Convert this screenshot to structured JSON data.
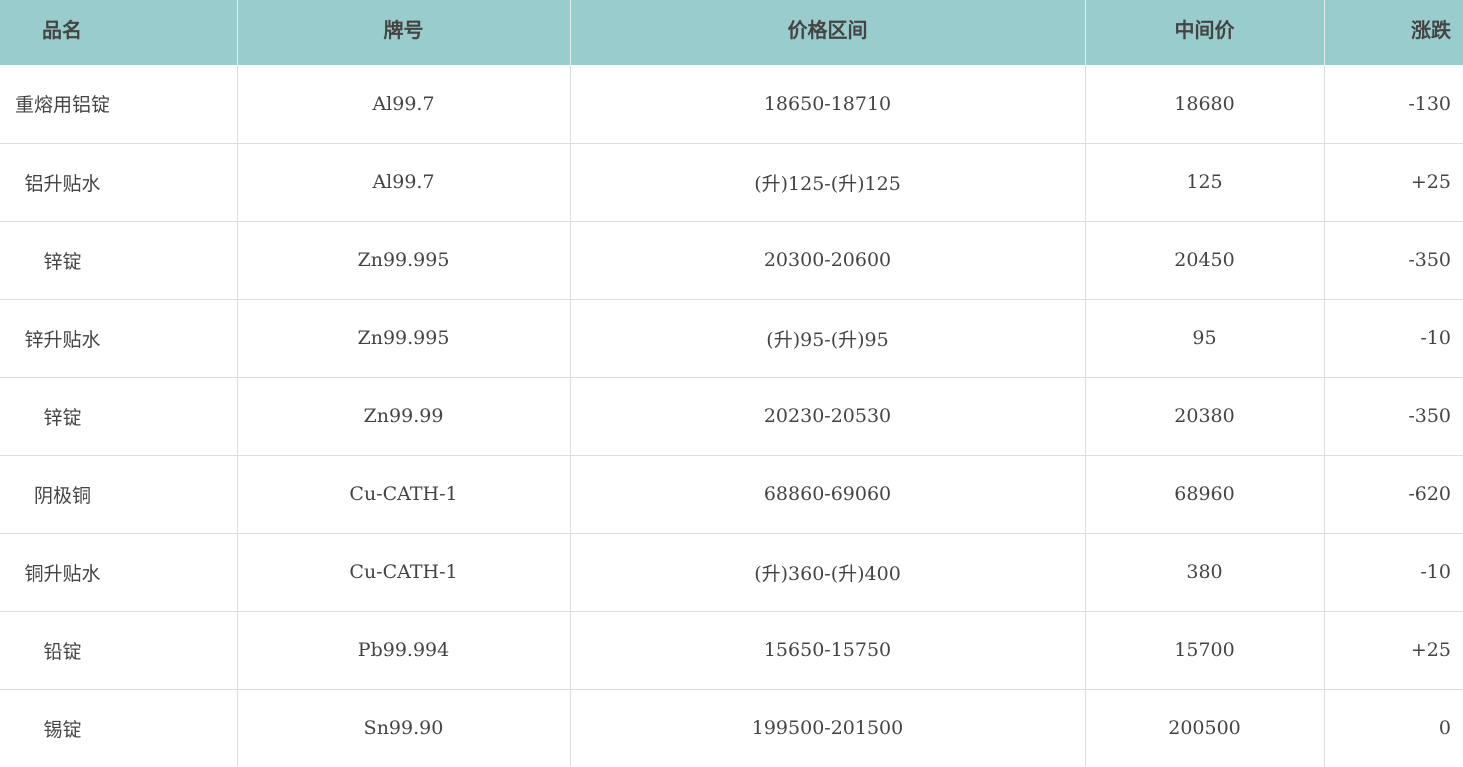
{
  "table": {
    "headers": {
      "name": "品名",
      "grade": "牌号",
      "range": "价格区间",
      "mid": "中间价",
      "change": "涨跌"
    },
    "rows": [
      {
        "name": "重熔用铝锭",
        "grade": "Al99.7",
        "range": "18650-18710",
        "mid": "18680",
        "change": "-130"
      },
      {
        "name": "铝升贴水",
        "grade": "Al99.7",
        "range": "(升)125-(升)125",
        "mid": "125",
        "change": "+25"
      },
      {
        "name": "锌锭",
        "grade": "Zn99.995",
        "range": "20300-20600",
        "mid": "20450",
        "change": "-350"
      },
      {
        "name": "锌升贴水",
        "grade": "Zn99.995",
        "range": "(升)95-(升)95",
        "mid": "95",
        "change": "-10"
      },
      {
        "name": "锌锭",
        "grade": "Zn99.99",
        "range": "20230-20530",
        "mid": "20380",
        "change": "-350"
      },
      {
        "name": "阴极铜",
        "grade": "Cu-CATH-1",
        "range": "68860-69060",
        "mid": "68960",
        "change": "-620"
      },
      {
        "name": "铜升贴水",
        "grade": "Cu-CATH-1",
        "range": "(升)360-(升)400",
        "mid": "380",
        "change": "-10"
      },
      {
        "name": "铅锭",
        "grade": "Pb99.994",
        "range": "15650-15750",
        "mid": "15700",
        "change": "+25"
      },
      {
        "name": "锡锭",
        "grade": "Sn99.90",
        "range": "199500-201500",
        "mid": "200500",
        "change": "0"
      }
    ]
  },
  "colors": {
    "header_bg": "#99cccc",
    "text": "#444444",
    "grid": "#dddddd"
  }
}
